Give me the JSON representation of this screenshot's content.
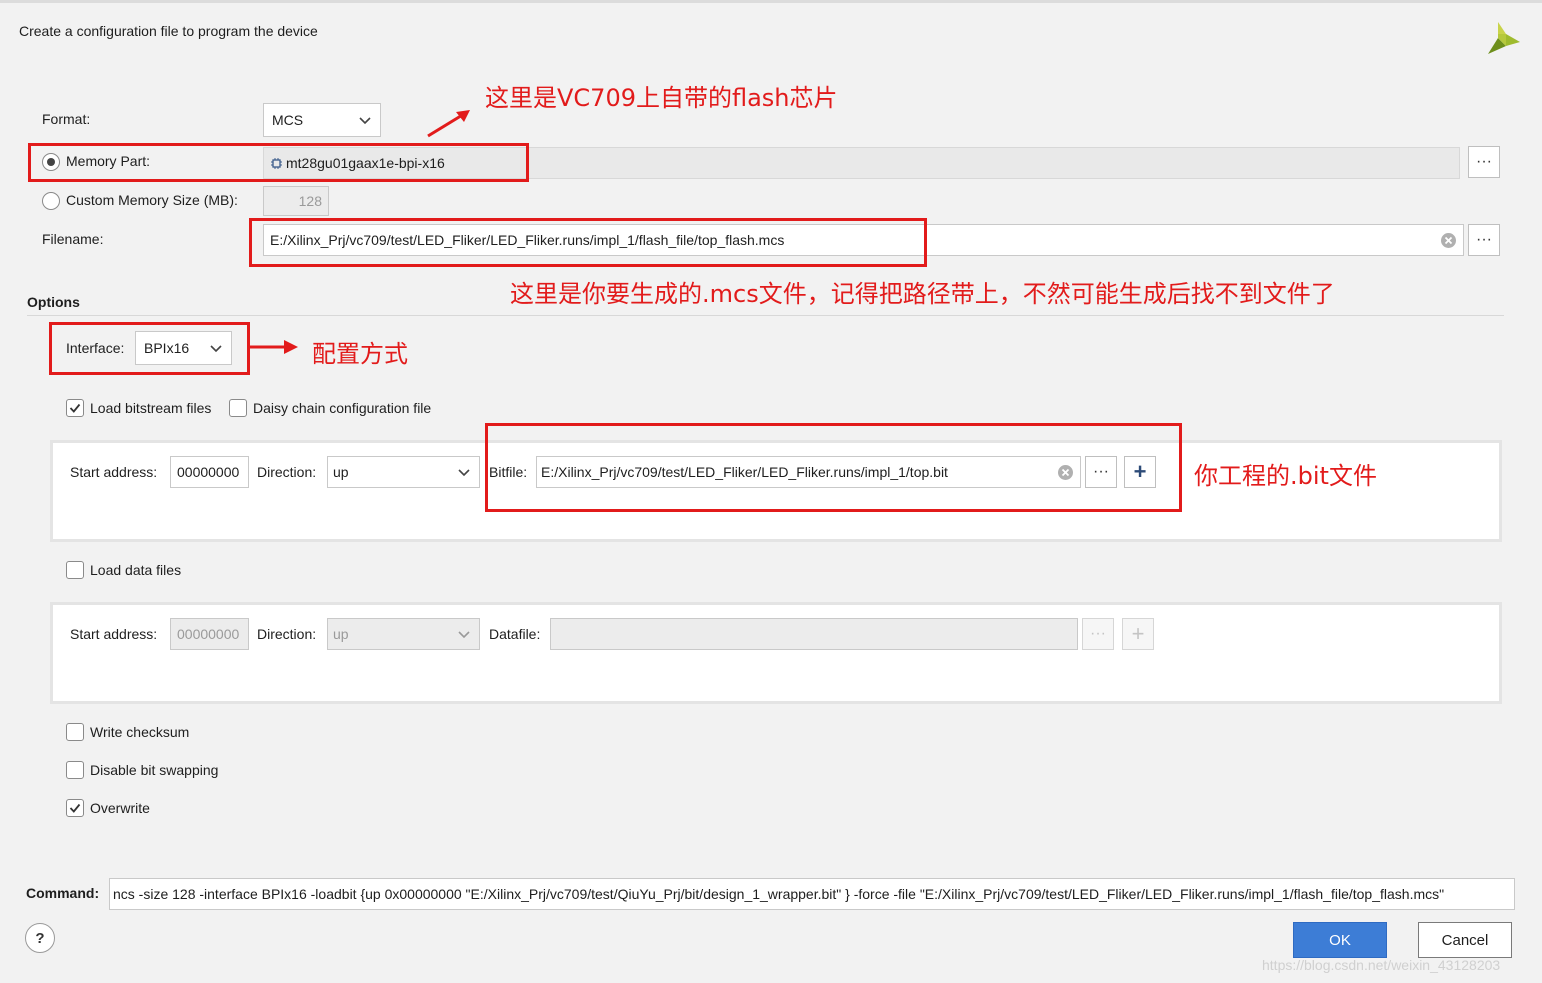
{
  "header": {
    "title": "Create a configuration file to program the device",
    "logo_icon": "xilinx-logo-icon"
  },
  "format": {
    "label": "Format:",
    "value": "MCS"
  },
  "memory_part": {
    "label": "Memory Part:",
    "value": "mt28gu01gaax1e-bpi-x16",
    "selected": true,
    "browse": "···"
  },
  "custom_size": {
    "label": "Custom Memory Size (MB):",
    "value": "128"
  },
  "filename": {
    "label": "Filename:",
    "value": "E:/Xilinx_Prj/vc709/test/LED_Fliker/LED_Fliker.runs/impl_1/flash_file/top_flash.mcs",
    "browse": "···"
  },
  "options": {
    "title": "Options",
    "interface": {
      "label": "Interface:",
      "value": "BPIx16"
    },
    "load_bitstream": {
      "label": "Load bitstream files",
      "checked": true
    },
    "daisy_chain": {
      "label": "Daisy chain configuration file",
      "checked": false
    },
    "bit_row": {
      "start_label": "Start address:",
      "start_value": "00000000",
      "direction_label": "Direction:",
      "direction_value": "up",
      "file_label": "Bitfile:",
      "file_value": "E:/Xilinx_Prj/vc709/test/LED_Fliker/LED_Fliker.runs/impl_1/top.bit",
      "browse": "···",
      "add": "+"
    },
    "load_data": {
      "label": "Load data files",
      "checked": false
    },
    "data_row": {
      "start_label": "Start address:",
      "start_value": "00000000",
      "direction_label": "Direction:",
      "direction_value": "up",
      "file_label": "Datafile:",
      "file_value": "",
      "browse": "···",
      "add": "+"
    },
    "write_checksum": {
      "label": "Write checksum",
      "checked": false
    },
    "disable_bit_swapping": {
      "label": "Disable bit swapping",
      "checked": false
    },
    "overwrite": {
      "label": "Overwrite",
      "checked": true
    }
  },
  "command": {
    "label": "Command:",
    "value": "ncs -size 128 -interface BPIx16 -loadbit {up 0x00000000 \"E:/Xilinx_Prj/vc709/test/QiuYu_Prj/bit/design_1_wrapper.bit\" } -force -file \"E:/Xilinx_Prj/vc709/test/LED_Fliker/LED_Fliker.runs/impl_1/flash_file/top_flash.mcs\""
  },
  "footer": {
    "help": "?",
    "ok": "OK",
    "cancel": "Cancel"
  },
  "annotations": {
    "flash_chip": "这里是VC709上自带的flash芯片",
    "mcs_file": "这里是你要生成的.mcs文件，记得把路径带上，不然可能生成后找不到文件了",
    "config_mode": "配置方式",
    "bit_file": "你工程的.bit文件"
  },
  "watermark": "https://blog.csdn.net/weixin_43128203",
  "colors": {
    "annotation_red": "#e21b1b",
    "ok_blue": "#3d7dd6"
  }
}
